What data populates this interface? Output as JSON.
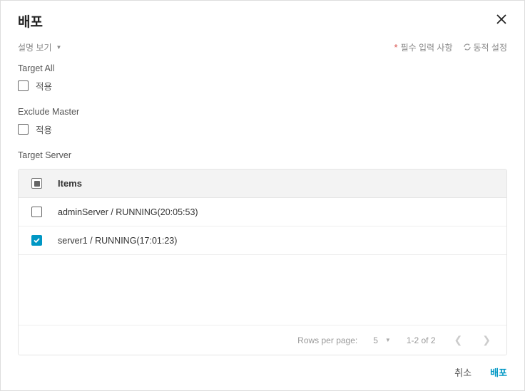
{
  "dialog": {
    "title": "배포"
  },
  "toolbar": {
    "desc_toggle": "설명 보기",
    "required_label": "필수 입력 사항",
    "dynamic_label": "동적 설정"
  },
  "sections": {
    "target_all": {
      "label": "Target All",
      "apply": "적용",
      "checked": false
    },
    "exclude_master": {
      "label": "Exclude Master",
      "apply": "적용",
      "checked": false
    },
    "target_server": {
      "label": "Target Server"
    }
  },
  "table": {
    "header": {
      "items": "Items"
    },
    "rows": [
      {
        "checked": false,
        "text": "adminServer / RUNNING(20:05:53)"
      },
      {
        "checked": true,
        "text": "server1 / RUNNING(17:01:23)"
      }
    ],
    "select_all_state": "indeterminate",
    "pagination": {
      "rows_per_page_label": "Rows per page:",
      "rows_per_page_value": "5",
      "range": "1-2 of 2"
    }
  },
  "footer": {
    "cancel": "취소",
    "deploy": "배포"
  }
}
